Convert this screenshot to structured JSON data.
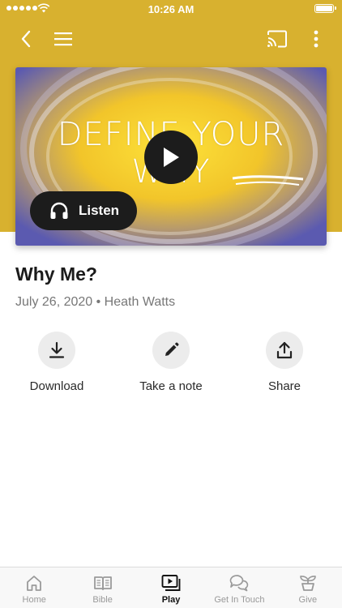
{
  "status_bar": {
    "time": "10:26 AM",
    "signal_icon": "signal-dots-icon",
    "wifi_icon": "wifi-icon",
    "battery_icon": "battery-icon"
  },
  "header": {
    "background": "#d8b12f",
    "back_icon": "chevron-left-icon",
    "menu_icon": "hamburger-menu-icon",
    "cast_icon": "cast-icon",
    "more_icon": "more-vertical-icon"
  },
  "hero": {
    "artwork_text": "DEFINE YOUR WHY",
    "play_icon": "play-icon",
    "listen_label": "Listen",
    "listen_icon": "headphones-icon"
  },
  "sermon": {
    "title": "Why Me?",
    "meta": "July 26, 2020 • Heath Watts"
  },
  "actions": [
    {
      "label": "Download",
      "icon": "download-icon"
    },
    {
      "label": "Take a note",
      "icon": "pencil-icon"
    },
    {
      "label": "Share",
      "icon": "share-icon"
    }
  ],
  "tabs": [
    {
      "label": "Home",
      "icon": "home-icon",
      "active": false
    },
    {
      "label": "Bible",
      "icon": "book-icon",
      "active": false
    },
    {
      "label": "Play",
      "icon": "play-video-icon",
      "active": true
    },
    {
      "label": "Get In Touch",
      "icon": "chat-bubbles-icon",
      "active": false
    },
    {
      "label": "Give",
      "icon": "plant-icon",
      "active": false
    }
  ],
  "colors": {
    "accent": "#d8b12f",
    "dark": "#1c1c1c",
    "action_circle": "#ececec"
  }
}
